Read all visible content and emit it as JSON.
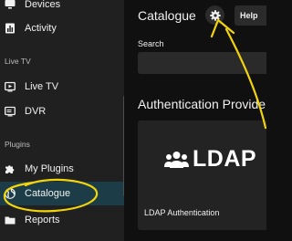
{
  "sidebar": {
    "items": [
      {
        "label": "Devices",
        "icon": "devices-icon"
      },
      {
        "label": "Activity",
        "icon": "activity-icon"
      },
      {
        "label": "Live TV",
        "icon": "live-tv-icon"
      },
      {
        "label": "DVR",
        "icon": "dvr-icon"
      },
      {
        "label": "My Plugins",
        "icon": "puzzle-icon"
      },
      {
        "label": "Catalogue",
        "icon": "globe-icon",
        "active": true
      },
      {
        "label": "Reports",
        "icon": "folder-icon"
      }
    ],
    "sections": {
      "live_tv": "Live TV",
      "plugins": "Plugins"
    }
  },
  "header": {
    "title": "Catalogue",
    "settings_icon": "gear-icon",
    "help_label": "Help"
  },
  "search": {
    "label": "Search",
    "value": "",
    "placeholder": ""
  },
  "category": {
    "title": "Authentication Providers"
  },
  "plugin": {
    "logo_text": "LDAP",
    "logo_icon": "users-icon",
    "name": "LDAP Authentication"
  },
  "colors": {
    "sidebar_bg": "#202020",
    "main_bg": "#101010",
    "active_bg": "#1c3c48",
    "annotation": "#f2d40c"
  }
}
